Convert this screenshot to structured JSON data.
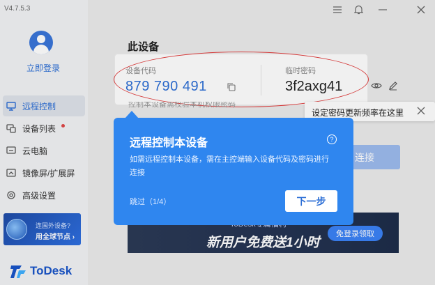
{
  "app": {
    "version": "V4.7.5.3"
  },
  "sidebar": {
    "login_label": "立即登录",
    "items": [
      {
        "label": "远程控制",
        "icon": "remote-control-icon",
        "active": true
      },
      {
        "label": "设备列表",
        "icon": "device-list-icon",
        "badge": true
      },
      {
        "label": "云电脑",
        "icon": "cloud-pc-icon"
      },
      {
        "label": "镜像屏/扩展屏",
        "icon": "mirror-screen-icon"
      },
      {
        "label": "高级设置",
        "icon": "gear-icon"
      }
    ],
    "promo": {
      "line1": "连国外设备?",
      "line2": "用全球节点 ›"
    },
    "logo_text": "ToDesk"
  },
  "main": {
    "title": "此设备",
    "device_code_label": "设备代码",
    "device_code": "879 790 491",
    "temp_password_label": "临时密码",
    "temp_password": "3f2axg41",
    "setting_hint": "设定密码更新频率在这里",
    "obscured_text": "控制本设备需校验本机权限密码",
    "connect_label": "连接",
    "banner": {
      "title": "ToDesk专属福利",
      "headline": "新用户免费送1小时",
      "button": "免登录领取"
    }
  },
  "guide": {
    "title": "远程控制本设备",
    "description": "如需远程控制本设备，需在主控端输入设备代码及密码进行连接",
    "help": "?",
    "skip": "跳过（1/4）",
    "next": "下一步"
  },
  "colors": {
    "accent": "#2d6fd6",
    "guide_bg": "#2f86ef",
    "highlight": "#e23c3c"
  }
}
